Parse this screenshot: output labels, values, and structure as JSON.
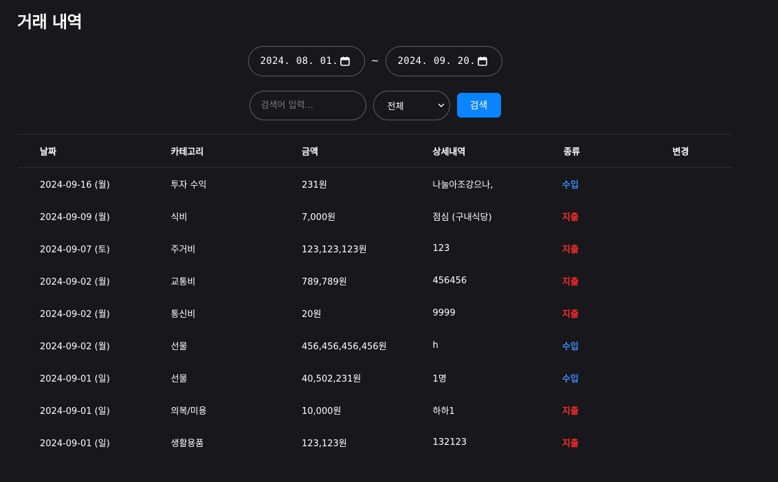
{
  "page": {
    "title": "거래 내역"
  },
  "filters": {
    "start_date": "2024. 08. 01.",
    "end_date": "2024. 09. 20.",
    "separator": "~",
    "search_placeholder": "검색어 입력...",
    "search_value": "",
    "type_select": "전체",
    "search_button": "검색"
  },
  "colors": {
    "income": "#3b8ff5",
    "expense": "#ff2d2d",
    "accent": "#0a84ff",
    "background": "#18171b"
  },
  "table": {
    "headers": [
      "날짜",
      "카테고리",
      "금액",
      "상세내역",
      "종류",
      "변경"
    ],
    "rows": [
      {
        "date": "2024-09-16 (월)",
        "category": "투자 수익",
        "amount": "231원",
        "detail": "나눌아조강으나,",
        "type": "수입",
        "kind": "income"
      },
      {
        "date": "2024-09-09 (월)",
        "category": "식비",
        "amount": "7,000원",
        "detail": "점심 (구내식당)",
        "type": "지출",
        "kind": "expense"
      },
      {
        "date": "2024-09-07 (토)",
        "category": "주거비",
        "amount": "123,123,123원",
        "detail": "123",
        "type": "지출",
        "kind": "expense"
      },
      {
        "date": "2024-09-02 (월)",
        "category": "교통비",
        "amount": "789,789원",
        "detail": "456456",
        "type": "지출",
        "kind": "expense"
      },
      {
        "date": "2024-09-02 (월)",
        "category": "통신비",
        "amount": "20원",
        "detail": "9999",
        "type": "지출",
        "kind": "expense"
      },
      {
        "date": "2024-09-02 (월)",
        "category": "선물",
        "amount": "456,456,456,456원",
        "detail": "h",
        "type": "수입",
        "kind": "income"
      },
      {
        "date": "2024-09-01 (일)",
        "category": "선물",
        "amount": "40,502,231원",
        "detail": "1명",
        "type": "수입",
        "kind": "income"
      },
      {
        "date": "2024-09-01 (일)",
        "category": "의복/미용",
        "amount": "10,000원",
        "detail": "하하1",
        "type": "지출",
        "kind": "expense"
      },
      {
        "date": "2024-09-01 (일)",
        "category": "생활용품",
        "amount": "123,123원",
        "detail": "132123",
        "type": "지출",
        "kind": "expense"
      }
    ]
  }
}
